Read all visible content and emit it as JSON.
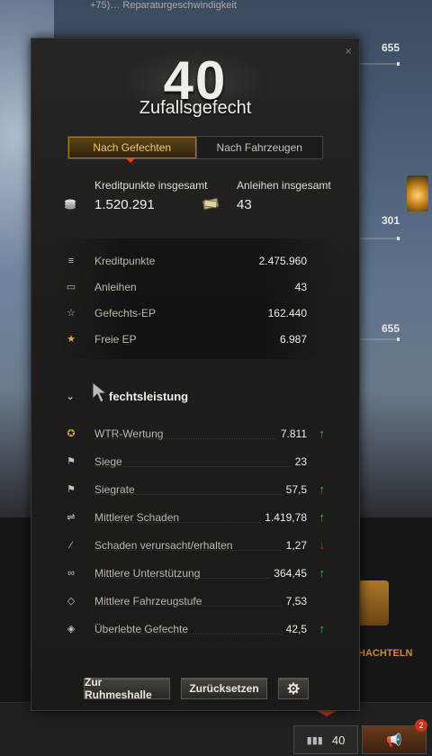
{
  "background": {
    "topbar_text": "+75)… Reparaturgeschwindigkeit",
    "right_values": [
      "655",
      "301",
      "655"
    ],
    "chest_label": "HACHTELN"
  },
  "panel": {
    "close_glyph": "×",
    "battle_count": "40",
    "battle_type": "Zufallsgefecht",
    "tabs": [
      {
        "label": "Nach Gefechten",
        "active": true
      },
      {
        "label": "Nach Fahrzeugen",
        "active": false
      }
    ],
    "summary": {
      "credits_label": "Kreditpunkte insgesamt",
      "credits_value": "1.520.291",
      "bonds_label": "Anleihen insgesamt",
      "bonds_value": "43"
    },
    "details": [
      {
        "icon": "credits-icon",
        "label": "Kreditpunkte",
        "value": "2.475.960"
      },
      {
        "icon": "bonds-icon",
        "label": "Anleihen",
        "value": "43"
      },
      {
        "icon": "star-outline-icon",
        "label": "Gefechts-EP",
        "value": "162.440"
      },
      {
        "icon": "star-filled-icon",
        "label": "Freie EP",
        "value": "6.987"
      }
    ],
    "section_title": "fechtsleistung",
    "performance": [
      {
        "icon": "wtr-rating-icon",
        "label": "WTR-Wertung",
        "value": "7.811",
        "trend": "up"
      },
      {
        "icon": "flag-icon",
        "label": "Siege",
        "value": "23",
        "trend": ""
      },
      {
        "icon": "flag-icon",
        "label": "Siegrate",
        "value": "57,5",
        "trend": "up"
      },
      {
        "icon": "damage-icon",
        "label": "Mittlerer Schaden",
        "value": "1.419,78",
        "trend": "up"
      },
      {
        "icon": "damage-ratio-icon",
        "label": "Schaden verursacht/erhalten",
        "value": "1,27",
        "trend": "down"
      },
      {
        "icon": "assist-icon",
        "label": "Mittlere Unterstützung",
        "value": "364,45",
        "trend": "up"
      },
      {
        "icon": "tier-icon",
        "label": "Mittlere Fahrzeugstufe",
        "value": "7,53",
        "trend": ""
      },
      {
        "icon": "survival-icon",
        "label": "Überlebte Gefechte",
        "value": "42,5",
        "trend": "up"
      }
    ],
    "buttons": {
      "hall_of_fame": "Zur Ruhmeshalle",
      "reset": "Zurücksetzen",
      "settings_icon": "gear-icon"
    }
  },
  "bottom_bar": {
    "session_count": "40",
    "notification_count": "2"
  },
  "colors": {
    "trend_up": "#38c844",
    "trend_down": "#d6301e",
    "tab_active": "#f6c66e"
  }
}
